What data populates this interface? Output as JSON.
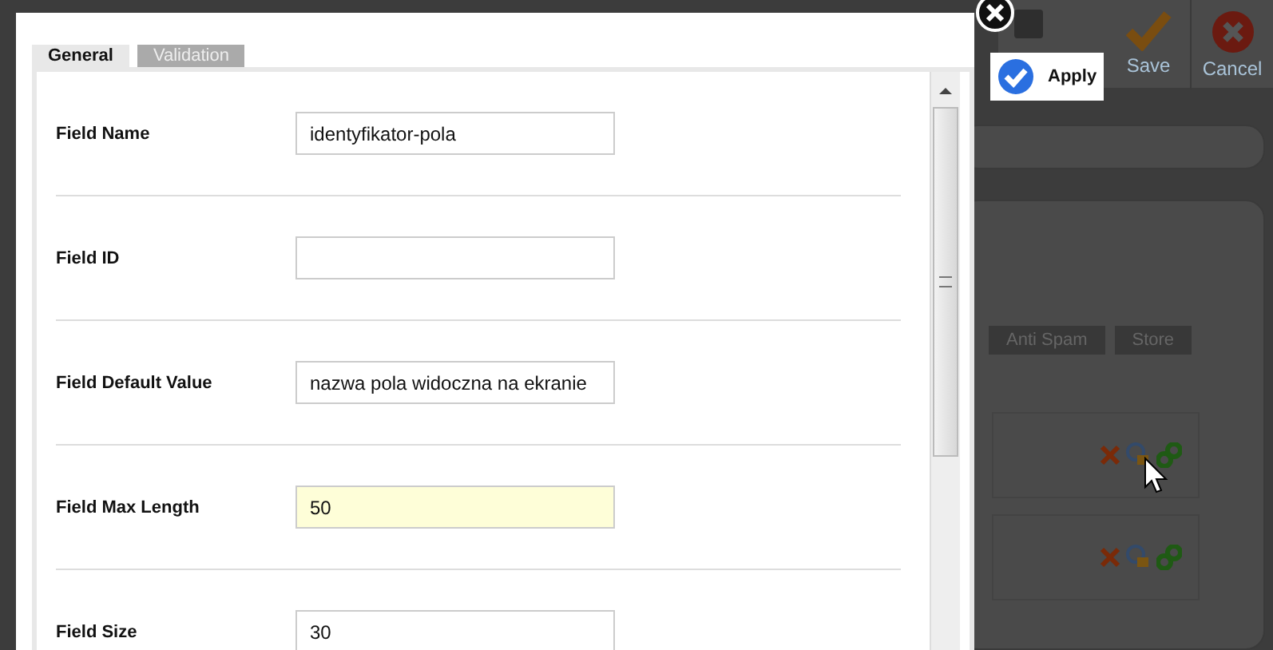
{
  "background": {
    "toolbar": [
      {
        "label": "Save",
        "kind": "check"
      },
      {
        "label": "Cancel",
        "kind": "cancel"
      }
    ],
    "tabs": [
      "Anti Spam",
      "Store"
    ],
    "rows": [
      {
        "kind": "field"
      },
      {
        "kind": "field"
      }
    ]
  },
  "dialog": {
    "tabs": [
      {
        "label": "General",
        "selected": true
      },
      {
        "label": "Validation",
        "selected": false
      }
    ],
    "fields": [
      {
        "label": "Field Name",
        "value": "identyfikator-pola",
        "focused": false
      },
      {
        "label": "Field ID",
        "focused": false
      },
      {
        "label": "Field Default Value",
        "value": "nazwa pola widoczna na ekranie",
        "focused": false
      },
      {
        "label": "Field Max Length",
        "value": "50",
        "focused": true
      },
      {
        "label": "Field Size",
        "value": "30",
        "focused": false
      }
    ],
    "apply": {
      "label": "Apply"
    }
  }
}
